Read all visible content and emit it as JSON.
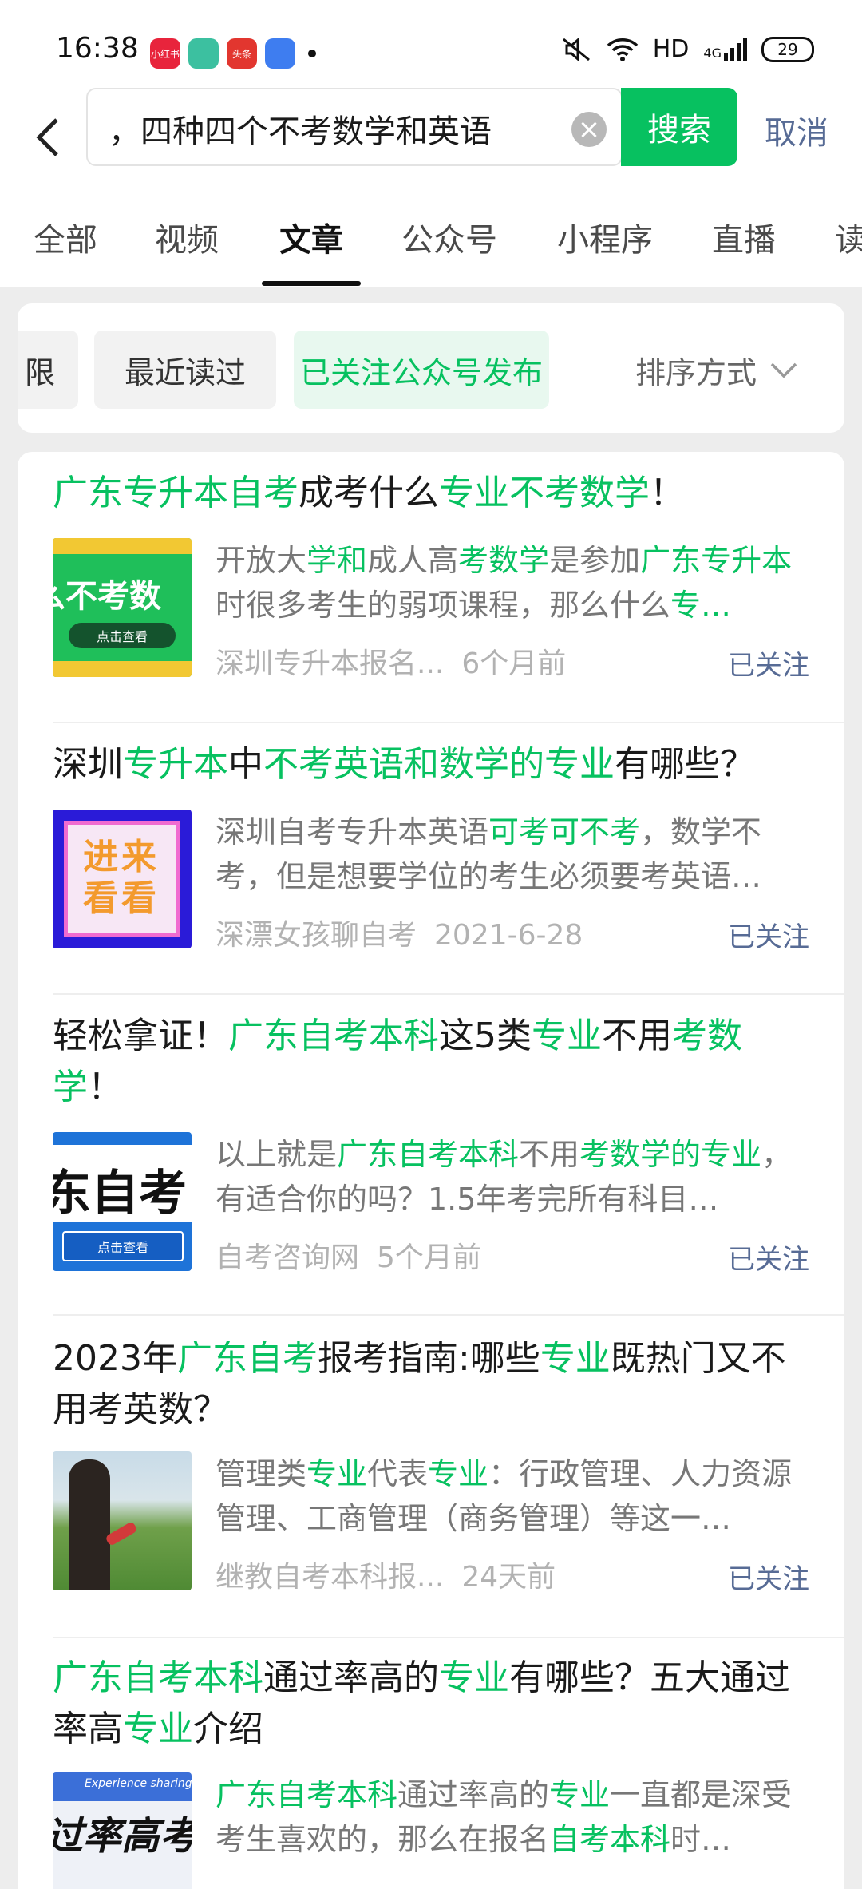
{
  "status": {
    "time": "16:38",
    "badges": [
      "小红书",
      "",
      "头条",
      ""
    ],
    "network": "HD",
    "signal": "4G",
    "battery": "29"
  },
  "search": {
    "query": "，四种四个不考数学和英语",
    "submit_label": "搜索",
    "cancel_label": "取消"
  },
  "tabs": [
    "全部",
    "视频",
    "文章",
    "公众号",
    "小程序",
    "直播",
    "读"
  ],
  "filters": {
    "chips": [
      "限",
      "最近读过",
      "已关注公众号发布"
    ],
    "sort_label": "排序方式"
  },
  "results": [
    {
      "title": [
        {
          "t": "广东专升本自考",
          "h": true
        },
        {
          "t": "成考什么",
          "h": false
        },
        {
          "t": "专业不考数学",
          "h": true
        },
        {
          "t": "！",
          "h": false
        }
      ],
      "snippet": [
        {
          "t": "开放大",
          "h": false
        },
        {
          "t": "学和",
          "h": true
        },
        {
          "t": "成人高",
          "h": false
        },
        {
          "t": "考数学",
          "h": true
        },
        {
          "t": "是参加",
          "h": false
        },
        {
          "t": "广东专升本",
          "h": true
        },
        {
          "t": "时很多考生的弱项课程，那么什么",
          "h": false
        },
        {
          "t": "专…",
          "h": true
        }
      ],
      "source": "深圳专升本报名...",
      "time": "6个月前",
      "follow": "已关注",
      "thumb_text": "么不考数",
      "thumb_button": "点击查看"
    },
    {
      "title": [
        {
          "t": "深圳",
          "h": false
        },
        {
          "t": "专升本",
          "h": true
        },
        {
          "t": "中",
          "h": false
        },
        {
          "t": "不考英语和数学的专业",
          "h": true
        },
        {
          "t": "有哪些？",
          "h": false
        }
      ],
      "snippet": [
        {
          "t": "深圳自考专升本英语",
          "h": false
        },
        {
          "t": "可考可不考",
          "h": true
        },
        {
          "t": "，数学不考，但是想要学位的考生必须要考英语…",
          "h": false
        }
      ],
      "source": "深漂女孩聊自考",
      "time": "2021-6-28",
      "follow": "已关注",
      "thumb_text": "进来看看"
    },
    {
      "title": [
        {
          "t": "轻松拿证！",
          "h": false
        },
        {
          "t": "广东自考本科",
          "h": true
        },
        {
          "t": "这5类",
          "h": false
        },
        {
          "t": "专业",
          "h": true
        },
        {
          "t": "不用",
          "h": false
        },
        {
          "t": "考数学",
          "h": true
        },
        {
          "t": "！",
          "h": false
        }
      ],
      "snippet": [
        {
          "t": "以上就是",
          "h": false
        },
        {
          "t": "广东自考本科",
          "h": true
        },
        {
          "t": "不用",
          "h": false
        },
        {
          "t": "考数学的专业",
          "h": true
        },
        {
          "t": "，有适合你的吗？1.5年考完所有科目…",
          "h": false
        }
      ],
      "source": "自考咨询网",
      "time": "5个月前",
      "follow": "已关注",
      "thumb_text": "东自考",
      "thumb_button": "点击查看"
    },
    {
      "title": [
        {
          "t": "2023年",
          "h": false
        },
        {
          "t": "广东自考",
          "h": true
        },
        {
          "t": "报考指南:哪些",
          "h": false
        },
        {
          "t": "专业",
          "h": true
        },
        {
          "t": "既热门又不用考英数？",
          "h": false
        }
      ],
      "snippet": [
        {
          "t": "管理类",
          "h": false
        },
        {
          "t": "专业",
          "h": true
        },
        {
          "t": "代表",
          "h": false
        },
        {
          "t": "专业",
          "h": true
        },
        {
          "t": "：行政管理、人力资源管理、工商管理（商务管理）等这一…",
          "h": false
        }
      ],
      "source": "继教自考本科报...",
      "time": "24天前",
      "follow": "已关注"
    },
    {
      "title": [
        {
          "t": "广东自考本科",
          "h": true
        },
        {
          "t": "通过率高的",
          "h": false
        },
        {
          "t": "专业",
          "h": true
        },
        {
          "t": "有哪些？五大通过率高",
          "h": false
        },
        {
          "t": "专业",
          "h": true
        },
        {
          "t": "介绍",
          "h": false
        }
      ],
      "snippet": [
        {
          "t": "广东自考本科",
          "h": true
        },
        {
          "t": "通过率高的",
          "h": false
        },
        {
          "t": "专业",
          "h": true
        },
        {
          "t": "一直都是深受考生喜欢的，那么在报名",
          "h": false
        },
        {
          "t": "自考本科",
          "h": true
        },
        {
          "t": "时…",
          "h": false
        }
      ],
      "thumb_text": "过率高考",
      "thumb_caption": "Experience sharing"
    }
  ]
}
